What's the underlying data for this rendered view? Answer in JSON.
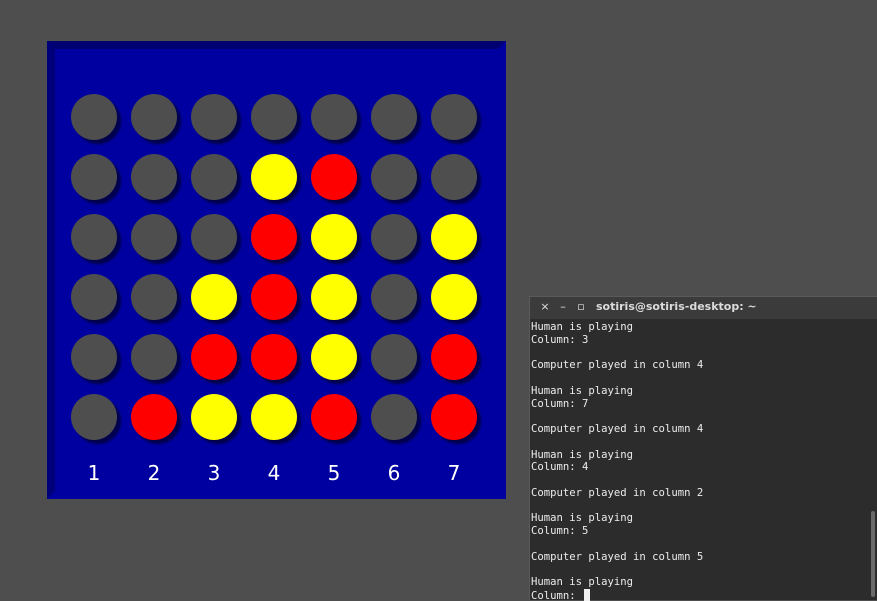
{
  "board": {
    "columns": [
      "1",
      "2",
      "3",
      "4",
      "5",
      "6",
      "7"
    ],
    "rows": [
      [
        "empty",
        "empty",
        "empty",
        "empty",
        "empty",
        "empty",
        "empty"
      ],
      [
        "empty",
        "empty",
        "empty",
        "yellow",
        "red",
        "empty",
        "empty"
      ],
      [
        "empty",
        "empty",
        "empty",
        "red",
        "yellow",
        "empty",
        "yellow"
      ],
      [
        "empty",
        "empty",
        "yellow",
        "red",
        "yellow",
        "empty",
        "yellow"
      ],
      [
        "empty",
        "empty",
        "red",
        "red",
        "yellow",
        "empty",
        "red"
      ],
      [
        "empty",
        "red",
        "yellow",
        "yellow",
        "red",
        "empty",
        "red"
      ]
    ],
    "colors": {
      "board": "#0000a0",
      "empty": "#4e4e4e",
      "red": "#ff0000",
      "yellow": "#ffff00"
    }
  },
  "terminal": {
    "title": "sotiris@sotiris-desktop: ~",
    "buttons": {
      "close": "×",
      "minimize": "–",
      "maximize": "▫"
    },
    "lines": [
      "Human is playing",
      "Column: 3",
      "",
      "Computer played in column 4",
      "",
      "Human is playing",
      "Column: 7",
      "",
      "Computer played in column 4",
      "",
      "Human is playing",
      "Column: 4",
      "",
      "Computer played in column 2",
      "",
      "Human is playing",
      "Column: 5",
      "",
      "Computer played in column 5",
      "",
      "Human is playing",
      "Column: "
    ]
  }
}
